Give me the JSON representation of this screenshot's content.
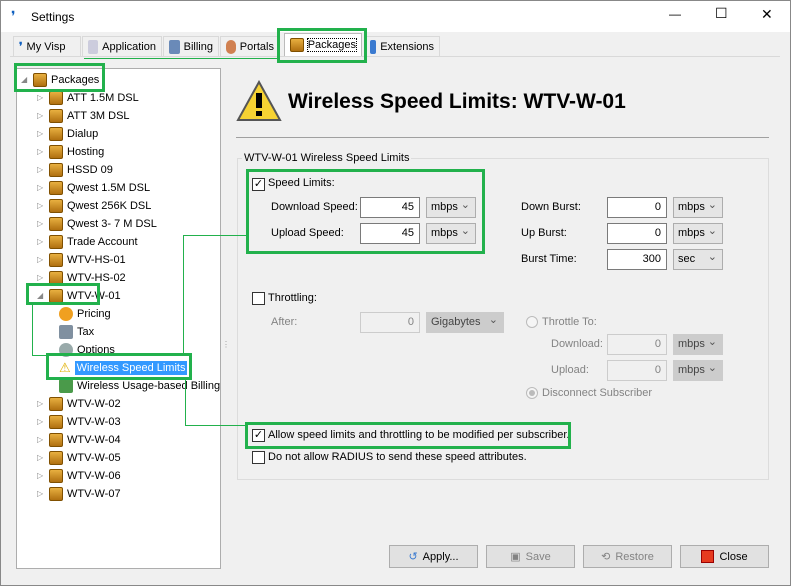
{
  "window": {
    "title": "Settings",
    "minimize": "—",
    "maximize": "☐",
    "close": "✕"
  },
  "tabs": [
    {
      "label": "My Visp"
    },
    {
      "label": "Application"
    },
    {
      "label": "Billing"
    },
    {
      "label": "Portals"
    },
    {
      "label": "Packages",
      "active": true
    },
    {
      "label": "Extensions"
    }
  ],
  "tree": {
    "root": "Packages",
    "items": [
      "ATT 1.5M DSL",
      "ATT 3M DSL",
      "Dialup",
      "Hosting",
      "HSSD 09",
      "Qwest 1.5M DSL",
      "Qwest 256K DSL",
      "Qwest 3- 7 M DSL",
      "Trade Account",
      "WTV-HS-01",
      "WTV-HS-02",
      "WTV-W-01"
    ],
    "children": [
      "Pricing",
      "Tax",
      "Options",
      "Wireless Speed Limits",
      "Wireless Usage-based Billing"
    ],
    "after": [
      "WTV-W-02",
      "WTV-W-03",
      "WTV-W-04",
      "WTV-W-05",
      "WTV-W-06",
      "WTV-W-07"
    ],
    "selected": "Wireless Speed Limits"
  },
  "header": {
    "title": "Wireless Speed Limits: WTV-W-01"
  },
  "group": {
    "title": "WTV-W-01 Wireless Speed Limits",
    "speed_limits": {
      "label": "Speed Limits:",
      "checked": true,
      "download_label": "Download Speed:",
      "download": "45",
      "download_unit": "mbps",
      "upload_label": "Upload Speed:",
      "upload": "45",
      "upload_unit": "mbps"
    },
    "burst": {
      "down_label": "Down Burst:",
      "down": "0",
      "down_unit": "mbps",
      "up_label": "Up Burst:",
      "up": "0",
      "up_unit": "mbps",
      "time_label": "Burst Time:",
      "time": "300",
      "time_unit": "sec"
    },
    "throttling": {
      "label": "Throttling:",
      "checked": false,
      "after_label": "After:",
      "after": "0",
      "after_unit": "Gigabytes",
      "throttle_to": "Throttle To:",
      "download_label": "Download:",
      "download": "0",
      "download_unit": "mbps",
      "upload_label": "Upload:",
      "upload": "0",
      "upload_unit": "mbps",
      "disconnect": "Disconnect Subscriber"
    },
    "allow_modify": {
      "label": "Allow speed limits and throttling to be modified per subscriber.",
      "checked": true
    },
    "no_radius": {
      "label": "Do not allow RADIUS to send these speed attributes.",
      "checked": false
    }
  },
  "buttons": {
    "apply": "Apply...",
    "save": "Save",
    "restore": "Restore",
    "close": "Close"
  }
}
